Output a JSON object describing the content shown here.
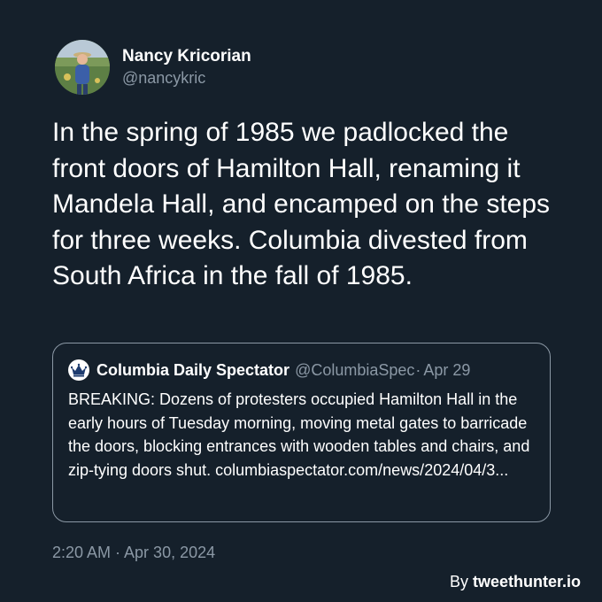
{
  "author": {
    "display_name": "Nancy Kricorian",
    "handle": "@nancykric",
    "avatar_icon": "profile-photo"
  },
  "tweet": {
    "text": "In the spring of 1985 we padlocked the front doors of Hamilton Hall, renaming it Mandela Hall, and encamped on the steps for three weeks. Columbia divested from South Africa in the fall of 1985.",
    "timestamp": "2:20 AM · Apr 30, 2024"
  },
  "quote": {
    "icon": "crown-icon",
    "name": "Columbia Daily Spectator",
    "handle": "@ColumbiaSpec",
    "separator": "·",
    "date": "Apr 29",
    "text": "BREAKING: Dozens of protesters occupied Hamilton Hall in the early hours of Tuesday morning, moving metal gates to barricade the doors, blocking entrances with wooden tables and chairs, and zip-tying doors shut. columbiaspectator.com/news/2024/04/3..."
  },
  "credit": {
    "prefix": "By",
    "brand": "tweethunter.io"
  },
  "colors": {
    "background": "#15202b",
    "text": "#ffffff",
    "muted": "#8b98a5",
    "border": "#8b98a5"
  }
}
